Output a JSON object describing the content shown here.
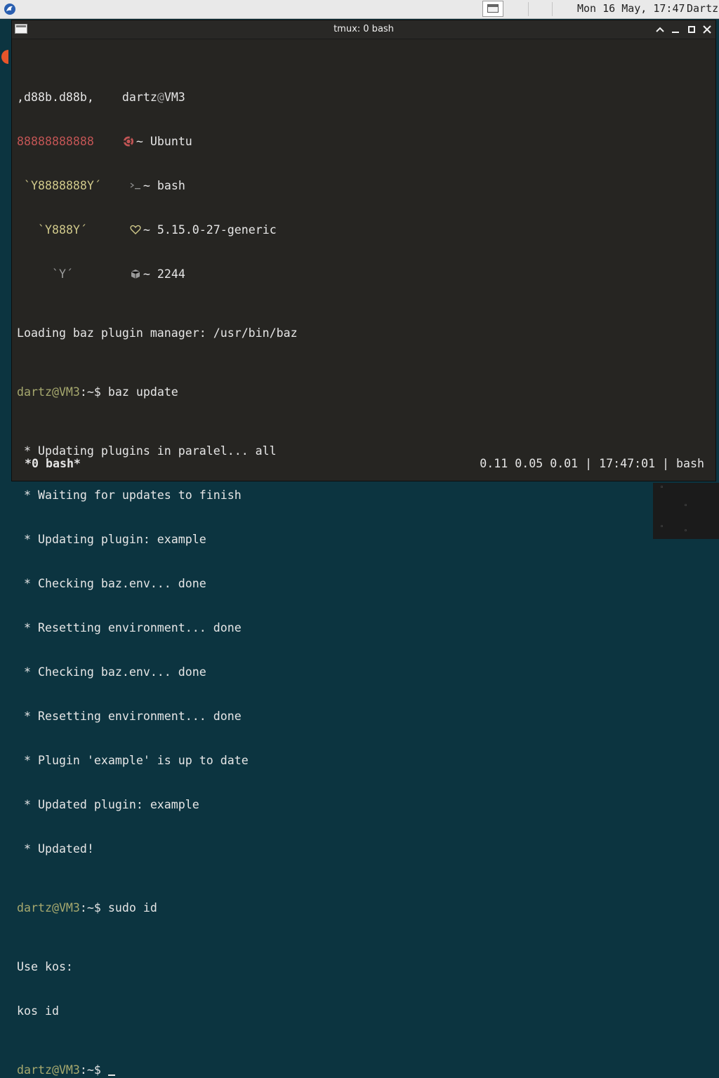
{
  "panel": {
    "clock": "Mon 16 May, 17:47",
    "user": "Dartz",
    "task_button_icon": "window-icon",
    "start_icon": "start-menu-icon"
  },
  "window": {
    "title": "tmux: 0 bash",
    "controls": [
      "maximize-up-icon",
      "minimize-icon",
      "restore-icon",
      "close-icon"
    ]
  },
  "fetch": {
    "art": [
      ",d88b.d88b,",
      "88888888888",
      "`Y8888888Y´",
      "`Y888Y´",
      "`Y´"
    ],
    "user": "dartz",
    "at": "@",
    "host": "VM3",
    "items": [
      {
        "icon": "ubuntu-icon",
        "text": "~ Ubuntu"
      },
      {
        "icon": "shell-icon",
        "text": "~ bash"
      },
      {
        "icon": "heart-icon",
        "text": "~ 5.15.0-27-generic"
      },
      {
        "icon": "package-icon",
        "text": "~ 2244"
      }
    ]
  },
  "terminal": {
    "loading_line": "Loading baz plugin manager: /usr/bin/baz",
    "prompt": "dartz@VM3",
    "prompt_suffix": ":~$ ",
    "cmd1": "baz update",
    "output1": [
      " * Updating plugins in paralel... all",
      " * Waiting for updates to finish",
      " * Updating plugin: example",
      " * Checking baz.env... done",
      " * Resetting environment... done",
      " * Checking baz.env... done",
      " * Resetting environment... done",
      " * Plugin 'example' is up to date",
      " * Updated plugin: example",
      " * Updated!"
    ],
    "cmd2": "sudo id",
    "output2": [
      "Use kos:",
      "kos id"
    ]
  },
  "status": {
    "left": "*0 bash*",
    "right": "0.11 0.05 0.01 | 17:47:01 | bash"
  },
  "colors": {
    "terminal_bg": "#262522",
    "prompt": "#a6a86e",
    "art_red": "#c25555",
    "art_yellow": "#cfc88a",
    "desktop": "#0c3440"
  }
}
